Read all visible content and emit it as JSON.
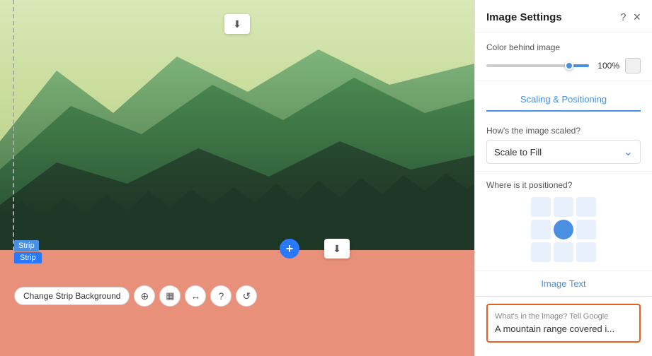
{
  "panel": {
    "title": "Image Settings",
    "help_icon": "?",
    "close_icon": "×"
  },
  "color_section": {
    "label": "Color behind image",
    "opacity_value": "100%",
    "slider_percent": 100
  },
  "scaling": {
    "tab_label": "Scaling & Positioning",
    "how_scaled_label": "How's the image scaled?",
    "scale_value": "Scale to Fill"
  },
  "position": {
    "label": "Where is it positioned?",
    "active_cell": 4
  },
  "image_text": {
    "tab_label": "Image Text",
    "hint": "What's in the image? Tell Google",
    "value": "A mountain range covered i..."
  },
  "toolbar": {
    "change_strip_label": "Change Strip Background",
    "strip_label_1": "Strip",
    "strip_label_2": "Strip"
  },
  "icons": {
    "download": "⬇",
    "add": "+",
    "layers": "⊕",
    "grid": "⊞",
    "arrow": "↔",
    "help": "?",
    "refresh": "↺"
  }
}
